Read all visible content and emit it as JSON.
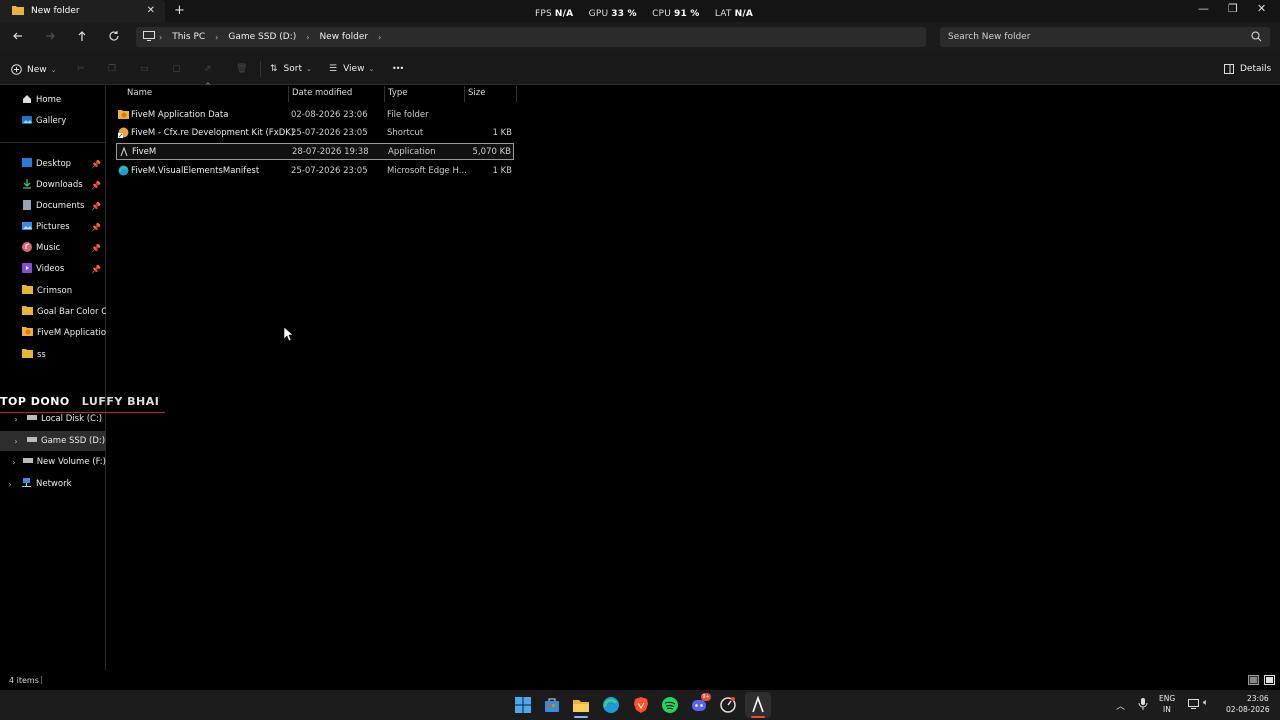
{
  "window": {
    "tab_title": "New folder",
    "controls": {
      "minimize": "—",
      "maximize": "❐",
      "close": "✕"
    }
  },
  "overlay": {
    "fps_label": "FPS",
    "fps_value": "N/A",
    "gpu_label": "GPU",
    "gpu_value": "33 %",
    "cpu_label": "CPU",
    "cpu_value": "91 %",
    "lat_label": "LAT",
    "lat_value": "N/A"
  },
  "breadcrumb": [
    "This PC",
    "Game SSD (D:)",
    "New folder"
  ],
  "search": {
    "placeholder": "Search New folder"
  },
  "toolbar": {
    "new_label": "New",
    "sort_label": "Sort",
    "view_label": "View",
    "more_label": "•••",
    "details_label": "Details"
  },
  "sidebar": {
    "items": [
      {
        "label": "Home",
        "icon": "home-icon"
      },
      {
        "label": "Gallery",
        "icon": "gallery-icon"
      },
      {
        "label": "Desktop",
        "icon": "desktop-icon",
        "pinned": true
      },
      {
        "label": "Downloads",
        "icon": "downloads-icon",
        "pinned": true
      },
      {
        "label": "Documents",
        "icon": "documents-icon",
        "pinned": true
      },
      {
        "label": "Pictures",
        "icon": "pictures-icon",
        "pinned": true
      },
      {
        "label": "Music",
        "icon": "music-icon",
        "pinned": true
      },
      {
        "label": "Videos",
        "icon": "videos-icon",
        "pinned": true
      },
      {
        "label": "Crimson",
        "icon": "folder-icon"
      },
      {
        "label": "Goal Bar Color Opti",
        "icon": "folder-icon"
      },
      {
        "label": "FiveM Application I",
        "icon": "fivem-folder-icon"
      },
      {
        "label": "ss",
        "icon": "folder-icon"
      }
    ],
    "drives": [
      {
        "label": "Local Disk (C:)"
      },
      {
        "label": "Game SSD (D:)",
        "selected": true
      },
      {
        "label": "New Volume (F:)"
      }
    ],
    "network_label": "Network"
  },
  "watermark": {
    "left": "TOP DONO",
    "right": "LUFFY BHAI",
    "line_color": "#c0282e"
  },
  "columns": {
    "name": "Name",
    "date": "Date modified",
    "type": "Type",
    "size": "Size"
  },
  "files": [
    {
      "name": "FiveM Application Data",
      "date": "02-08-2026 23:06",
      "type": "File folder",
      "size": "",
      "icon": "fivem-folder-icon"
    },
    {
      "name": "FiveM - Cfx.re Development Kit (FxDK)",
      "date": "25-07-2026 23:05",
      "type": "Shortcut",
      "size": "1 KB",
      "icon": "shortcut-icon"
    },
    {
      "name": "FiveM",
      "date": "28-07-2026 19:38",
      "type": "Application",
      "size": "5,070 KB",
      "icon": "fivem-app-icon",
      "selected": true
    },
    {
      "name": "FiveM.VisualElementsManifest",
      "date": "25-07-2026 23:05",
      "type": "Microsoft Edge H...",
      "size": "1 KB",
      "icon": "edge-icon"
    }
  ],
  "status": {
    "item_count": "4 items",
    "cursor": "|"
  },
  "taskbar": {
    "lang_top": "ENG",
    "lang_bottom": "IN",
    "time": "23:06",
    "date": "02-08-2026",
    "badge": "9+"
  },
  "colors": {
    "accent": "#0078d4",
    "folder": "#e8b53a",
    "background": "#000000"
  }
}
